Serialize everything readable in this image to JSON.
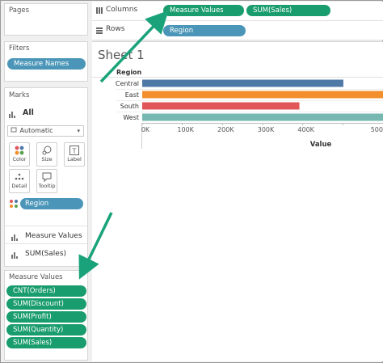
{
  "colors": {
    "pill_blue": "#4b96b8",
    "pill_green": "#1a9d6e",
    "arrow": "#1aa37a"
  },
  "left": {
    "pages_title": "Pages",
    "filters_title": "Filters",
    "filters_pill": "Measure Names",
    "marks_title": "Marks",
    "marks_all": "All",
    "marks_type": "Automatic",
    "mark_buttons": [
      {
        "label": "Color",
        "icon": "color-dots-icon"
      },
      {
        "label": "Size",
        "icon": "size-icon"
      },
      {
        "label": "Label",
        "icon": "label-icon"
      },
      {
        "label": "Detail",
        "icon": "detail-dots-icon"
      },
      {
        "label": "Tooltip",
        "icon": "tooltip-icon"
      }
    ],
    "marks_color_pill": "Region",
    "marks_measure_values": "Measure Values",
    "marks_sum_sales": "SUM(Sales)",
    "measure_values_title": "Measure Values",
    "measure_values_pills": [
      "CNT(Orders)",
      "SUM(Discount)",
      "SUM(Profit)",
      "SUM(Quantity)",
      "SUM(Sales)"
    ]
  },
  "shelves": {
    "columns_label": "Columns",
    "columns_pills": [
      "Measure Values",
      "SUM(Sales)"
    ],
    "rows_label": "Rows",
    "rows_pills": [
      "Region"
    ]
  },
  "sheet": {
    "title": "Sheet 1"
  },
  "chart_data": {
    "type": "bar",
    "orientation": "horizontal",
    "row_header": "Region",
    "categories": [
      "Central",
      "East",
      "South",
      "West"
    ],
    "values": [
      501240,
      678781,
      391722,
      725458
    ],
    "colors": [
      "#4e79a7",
      "#f28e2b",
      "#e15759",
      "#76b7b2"
    ],
    "xlabel": "Value",
    "xticks": [
      "0K",
      "100K",
      "200K",
      "300K",
      "400K",
      "500"
    ],
    "xlim": [
      0,
      500000
    ]
  }
}
